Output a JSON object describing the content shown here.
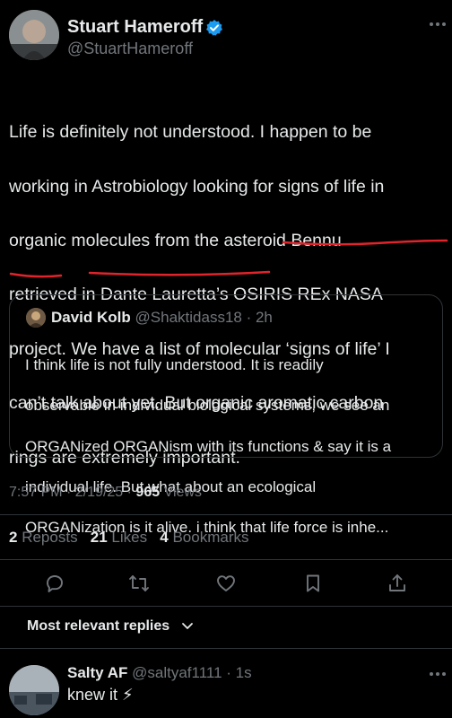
{
  "author": {
    "name": "Stuart Hameroff",
    "handle": "@StuartHameroff",
    "verified": true
  },
  "tweet": {
    "lines": [
      "Life is definitely not understood. I happen to be",
      "working in Astrobiology looking for signs of life in",
      "organic molecules from the asteroid Bennu",
      "retrieved in Dante Lauretta’s OSIRIS REx NASA",
      "project. We have a list of molecular ‘signs of life’ I",
      "can’t talk about yet. But organic aromatic carbon",
      "rings are extremely important."
    ]
  },
  "quote": {
    "name": "David Kolb",
    "handle": "@Shaktidass18",
    "time": "· 2h",
    "lines": [
      "I think life is not fully understood. It is readily",
      "observable in individual biological systems, we see an",
      "ORGANized ORGANism with its functions & say it is a",
      "individual life. But what about an ecological",
      "ORGANization is it alive. i think that life force is inhe..."
    ]
  },
  "meta": {
    "time": "7:57 PM · 2/19/25 ·",
    "views_count": "965",
    "views_label": "Views"
  },
  "stats": {
    "reposts_count": "2",
    "reposts_label": "Reposts",
    "likes_count": "21",
    "likes_label": "Likes",
    "bookmarks_count": "4",
    "bookmarks_label": "Bookmarks"
  },
  "replies_filter": {
    "label": "Most relevant replies"
  },
  "reply": {
    "name": "Salty AF",
    "handle": "@saltyaf1111",
    "time": "· 1s",
    "text": "knew it ⚡"
  },
  "colors": {
    "background": "#000000",
    "text": "#e7e9ea",
    "muted": "#71767b",
    "verified": "#1d9bf0",
    "annotation": "#e0242b"
  },
  "icons": [
    "more-icon",
    "verified-icon",
    "reply-icon",
    "repost-icon",
    "like-icon",
    "bookmark-icon",
    "share-icon",
    "chevron-down-icon"
  ]
}
